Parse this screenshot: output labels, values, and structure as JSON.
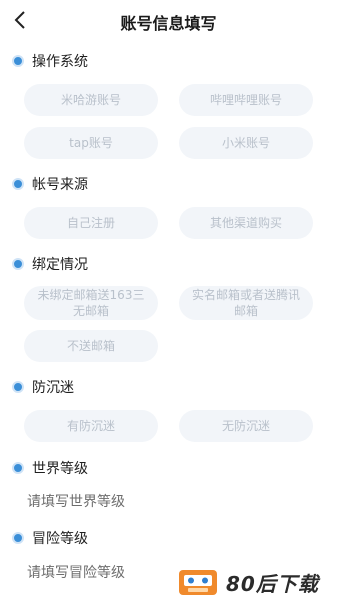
{
  "header": {
    "title": "账号信息填写"
  },
  "sections": {
    "os": {
      "label": "操作系统",
      "options": [
        "米哈游账号",
        "哔哩哔哩账号",
        "tap账号",
        "小米账号"
      ]
    },
    "source": {
      "label": "帐号来源",
      "options": [
        "自己注册",
        "其他渠道购买"
      ]
    },
    "binding": {
      "label": "绑定情况",
      "options": [
        "未绑定邮箱送163三无邮箱",
        "实名邮箱或者送腾讯邮箱",
        "不送邮箱"
      ]
    },
    "anti_addiction": {
      "label": "防沉迷",
      "options": [
        "有防沉迷",
        "无防沉迷"
      ]
    },
    "world_level": {
      "label": "世界等级",
      "placeholder": "请填写世界等级"
    },
    "adventure_level": {
      "label": "冒险等级",
      "placeholder": "请填写冒险等级"
    }
  },
  "watermark": {
    "text": "80后下载"
  },
  "colors": {
    "accent": "#3b8fd8",
    "chip_bg": "#f2f5f9",
    "chip_text": "#b9c1cb"
  }
}
